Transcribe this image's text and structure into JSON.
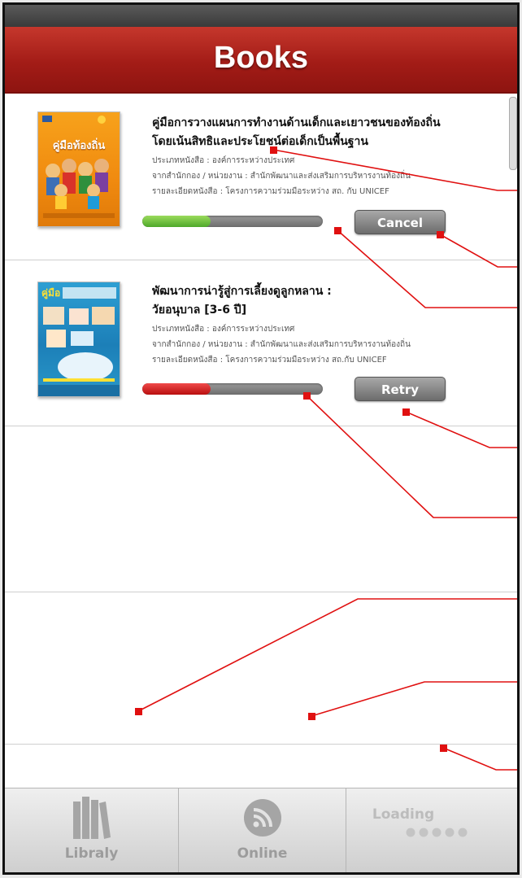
{
  "header": {
    "title": "Books"
  },
  "books": [
    {
      "title_line1": "คู่มือการวางแผนการทำงานด้านเด็กและเยาวชนของท้องถิ่น",
      "title_line2": "โดยเน้นสิทธิและประโยชน์ต่อเด็กเป็นพื้นฐาน",
      "meta_type": "ประเภทหนังสือ : องค์การระหว่างประเทศ",
      "meta_org": "จากสำนักกอง / หน่วยงาน : สำนักพัฒนาและส่งเสริมการบริหารงานท้องถิ่น",
      "meta_detail": "รายละเอียดหนังสือ : โครงการความร่วมมือระหว่าง สถ. กับ UNICEF",
      "cover_text": "คู่มือท้องถิ่น",
      "progress": 0.38,
      "progress_color": "green",
      "button_label": "Cancel"
    },
    {
      "title_line1": "พัฒนาการน่ารู้สู่การเลี้ยงดูลูกหลาน :",
      "title_line2": "วัยอนุบาล [3-6 ปี]",
      "meta_type": "ประเภทหนังสือ : องค์การระหว่างประเทศ",
      "meta_org": "จากสำนักกอง / หน่วยงาน : สำนักพัฒนาและส่งเสริมการบริหารงานท้องถิ่น",
      "meta_detail": "รายละเอียดหนังสือ       : โครงการความร่วมมือระหว่าง สถ.กับ UNICEF",
      "cover_text": "คู่มือ",
      "progress": 0.38,
      "progress_color": "red",
      "button_label": "Retry"
    }
  ],
  "tabs": [
    {
      "label": "Libraly",
      "icon": "library-books-icon"
    },
    {
      "label": "Online",
      "icon": "rss-feed-icon"
    },
    {
      "label": "Loading",
      "icon": "loading-dots-icon"
    }
  ],
  "colors": {
    "header": "#a31c17",
    "progress_ok": "#4ea82a",
    "progress_error": "#b90f0f",
    "annotation": "#e01010"
  }
}
